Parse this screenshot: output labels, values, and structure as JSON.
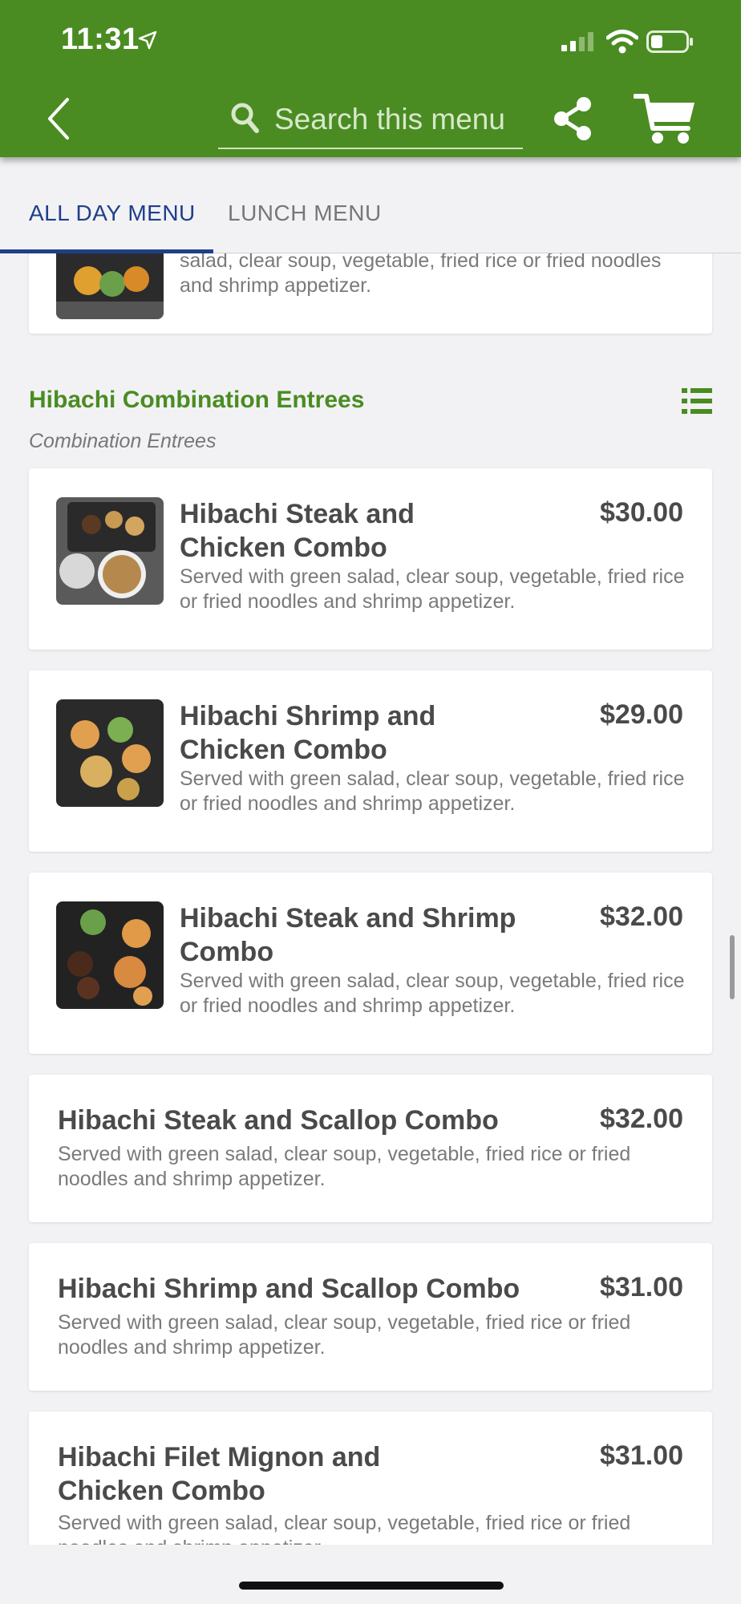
{
  "status_bar": {
    "time": "11:31"
  },
  "header": {
    "search_placeholder": "Search this menu"
  },
  "tabs": [
    {
      "label": "ALL DAY MENU",
      "active": true
    },
    {
      "label": "LUNCH MENU",
      "active": false
    }
  ],
  "partial_item": {
    "desc": "salad, clear soup, vegetable, fried rice or fried noodles and shrimp appetizer."
  },
  "section": {
    "title": "Hibachi Combination Entrees",
    "subtitle": "Combination Entrees"
  },
  "items": [
    {
      "name": "Hibachi Steak and Chicken Combo",
      "price": "$30.00",
      "desc": "Served with green salad, clear soup, vegetable, fried rice or fried noodles and shrimp appetizer."
    },
    {
      "name": "Hibachi Shrimp and Chicken Combo",
      "price": "$29.00",
      "desc": "Served with green salad, clear soup, vegetable, fried rice or fried noodles and shrimp appetizer."
    },
    {
      "name": "Hibachi Steak and Shrimp Combo",
      "price": "$32.00",
      "desc": "Served with green salad, clear soup, vegetable, fried rice or fried noodles and shrimp appetizer."
    },
    {
      "name": "Hibachi Steak and Scallop Combo",
      "price": "$32.00",
      "desc": "Served with green salad, clear soup, vegetable, fried rice or fried noodles and shrimp appetizer."
    },
    {
      "name": "Hibachi Shrimp and Scallop Combo",
      "price": "$31.00",
      "desc": "Served with green salad, clear soup, vegetable, fried rice or fried noodles and shrimp appetizer."
    },
    {
      "name": "Hibachi Filet Mignon and Chicken Combo",
      "price": "$31.00",
      "desc": "Served with green salad, clear soup, vegetable, fried rice or fried noodles and shrimp appetizer."
    }
  ],
  "colors": {
    "brand_green": "#4a8c22",
    "tab_active": "#1f3f8a"
  }
}
